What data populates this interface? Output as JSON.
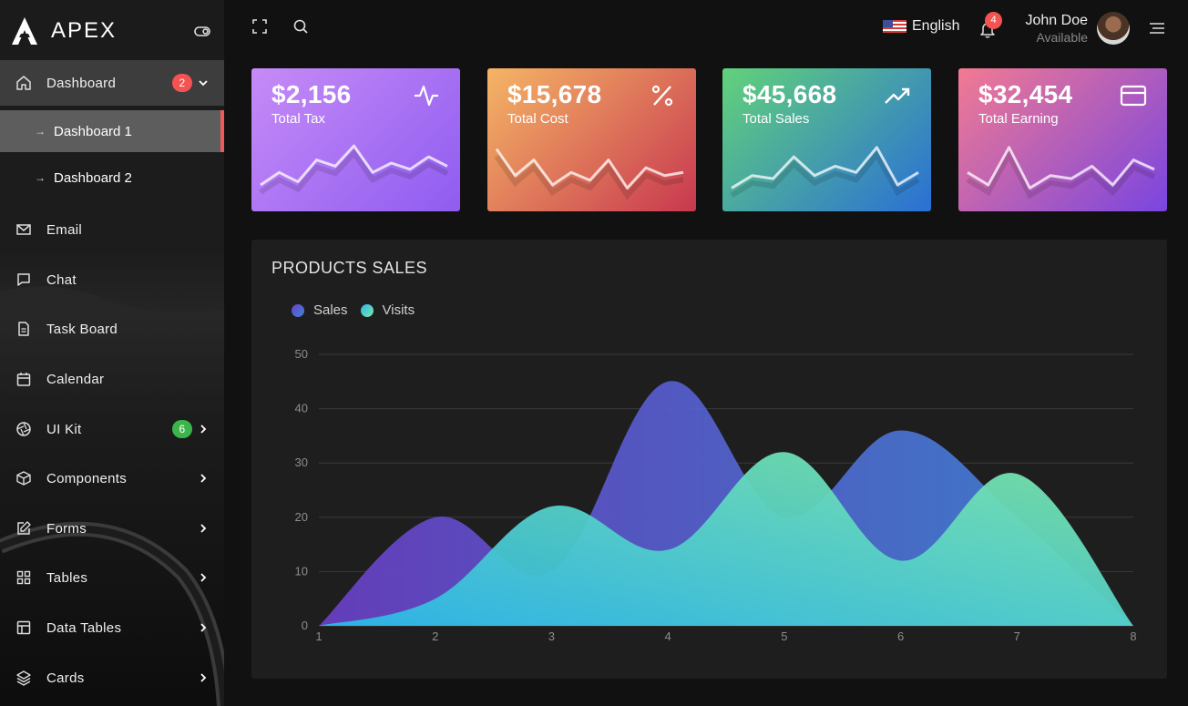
{
  "brand": {
    "name": "APEX"
  },
  "sidebar": {
    "items": [
      {
        "label": "Dashboard",
        "icon": "home-icon",
        "badge": "2",
        "badge_color": "#f55252",
        "chevron": "down"
      },
      {
        "label": "Email",
        "icon": "mail-icon"
      },
      {
        "label": "Chat",
        "icon": "chat-icon"
      },
      {
        "label": "Task Board",
        "icon": "file-icon"
      },
      {
        "label": "Calendar",
        "icon": "calendar-icon"
      },
      {
        "label": "UI Kit",
        "icon": "aperture-icon",
        "badge": "6",
        "badge_color": "#3bb54a",
        "chevron": "right"
      },
      {
        "label": "Components",
        "icon": "box-icon",
        "chevron": "right"
      },
      {
        "label": "Forms",
        "icon": "edit-icon",
        "chevron": "right"
      },
      {
        "label": "Tables",
        "icon": "grid-icon",
        "chevron": "right"
      },
      {
        "label": "Data Tables",
        "icon": "layout-icon",
        "chevron": "right"
      },
      {
        "label": "Cards",
        "icon": "layers-icon",
        "chevron": "right"
      }
    ],
    "sub_items": [
      {
        "label": "Dashboard 1",
        "active": true
      },
      {
        "label": "Dashboard 2",
        "active": false
      }
    ]
  },
  "topbar": {
    "language": "English",
    "notifications": "4",
    "user_name": "John Doe",
    "user_status": "Available"
  },
  "cards": [
    {
      "amount": "$2,156",
      "label": "Total Tax",
      "icon": "activity-icon",
      "gradient": [
        "#8f5cf0",
        "#c68bf7"
      ]
    },
    {
      "amount": "$15,678",
      "label": "Total Cost",
      "icon": "percent-icon",
      "gradient": [
        "#c8384f",
        "#f5b565"
      ]
    },
    {
      "amount": "$45,668",
      "label": "Total Sales",
      "icon": "trending-up-icon",
      "gradient": [
        "#2a6fd6",
        "#62d27a"
      ]
    },
    {
      "amount": "$32,454",
      "label": "Total Earning",
      "icon": "credit-card-icon",
      "gradient": [
        "#7a45e0",
        "#f27a92"
      ]
    }
  ],
  "sparklines": [
    [
      22,
      30,
      24,
      38,
      34,
      47,
      30,
      36,
      32,
      40,
      34
    ],
    [
      45,
      28,
      38,
      22,
      30,
      25,
      38,
      20,
      33,
      28,
      30
    ],
    [
      20,
      28,
      26,
      40,
      28,
      34,
      30,
      46,
      22,
      30
    ],
    [
      30,
      22,
      46,
      20,
      28,
      26,
      34,
      22,
      38,
      32
    ]
  ],
  "chart": {
    "title": "PRODUCTS SALES",
    "legend": [
      "Sales",
      "Visits"
    ]
  },
  "chart_data": {
    "type": "area",
    "x": [
      1,
      2,
      3,
      4,
      5,
      6,
      7,
      8
    ],
    "ylim": [
      0,
      50
    ],
    "y_ticks": [
      0,
      10,
      20,
      30,
      40,
      50
    ],
    "series": [
      {
        "name": "Sales",
        "values": [
          0,
          20,
          10,
          45,
          20,
          36,
          20,
          0
        ],
        "colors": [
          "#6a3fc6",
          "#3d86d8"
        ]
      },
      {
        "name": "Visits",
        "values": [
          0,
          5,
          22,
          14,
          32,
          12,
          28,
          0
        ],
        "colors": [
          "#2bb8e8",
          "#7ee8a8"
        ]
      }
    ],
    "grid": true,
    "legend_position": "top-left"
  }
}
